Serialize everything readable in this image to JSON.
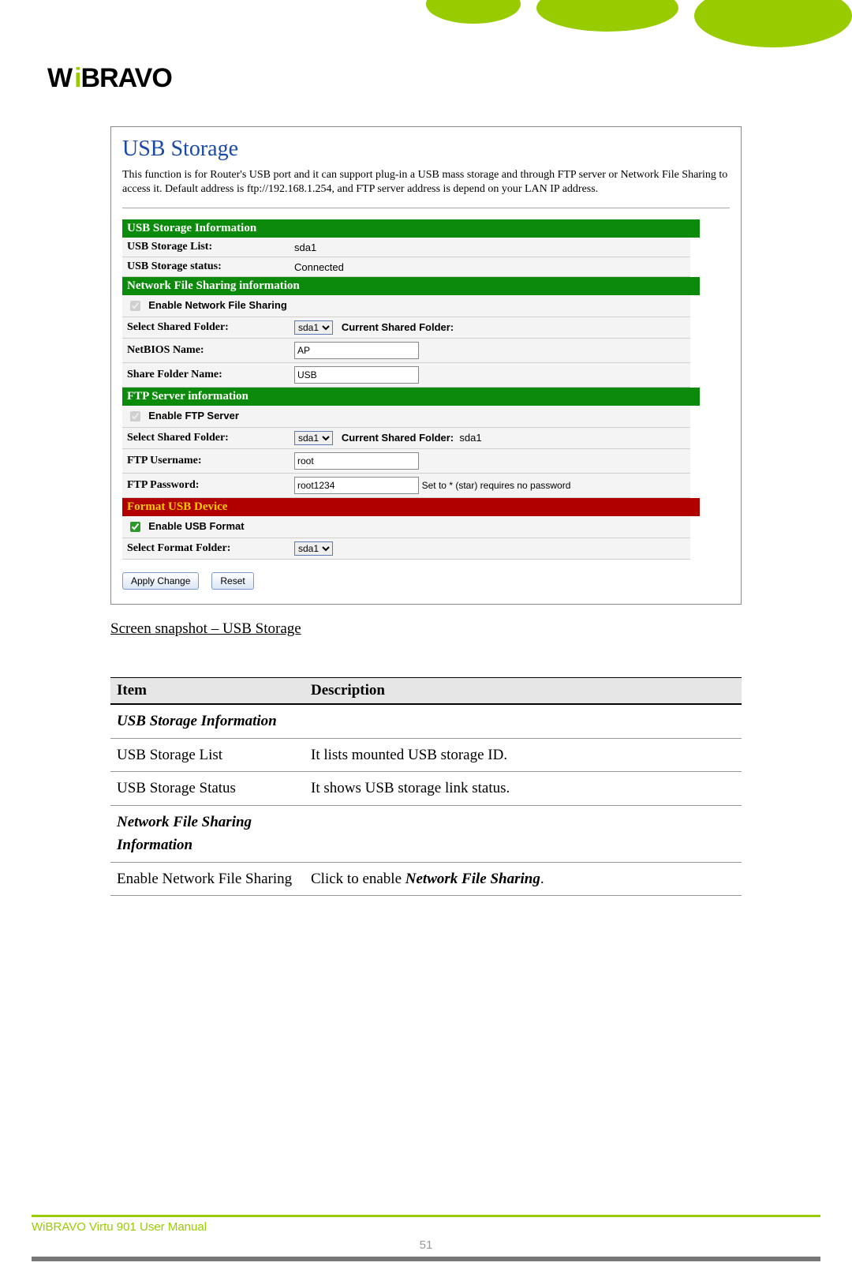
{
  "logo": {
    "text_a": "W",
    "text_dot": "i",
    "text_b": "BRAVO"
  },
  "screenshot": {
    "title": "USB Storage",
    "intro": "This function is for Router's USB port and it can support plug-in a USB mass storage and through FTP server or Network File Sharing to access it. Default address is ftp://192.168.1.254, and FTP server address is depend on your LAN IP address.",
    "sec_usb_info": "USB Storage Information",
    "usb_list_lbl": "USB Storage List:",
    "usb_list_val": "sda1",
    "usb_status_lbl": "USB Storage status:",
    "usb_status_val": "Connected",
    "sec_nfs": "Network File Sharing information",
    "en_nfs_lbl": "Enable Network File Sharing",
    "sel_folder_lbl": "Select Shared Folder:",
    "sel_folder_val": "sda1",
    "cur_folder_lbl": "Current Shared Folder:",
    "netbios_lbl": "NetBIOS Name:",
    "netbios_val": "AP",
    "share_name_lbl": "Share Folder Name:",
    "share_name_val": "USB",
    "sec_ftp": "FTP Server information",
    "en_ftp_lbl": "Enable FTP Server",
    "ftp_sel_folder_lbl": "Select Shared Folder:",
    "ftp_sel_folder_val": "sda1",
    "ftp_cur_folder_lbl": "Current Shared Folder:",
    "ftp_cur_folder_val": "sda1",
    "ftp_user_lbl": "FTP Username:",
    "ftp_user_val": "root",
    "ftp_pass_lbl": "FTP Password:",
    "ftp_pass_val": "root1234",
    "ftp_pass_note": "Set to * (star) requires no password",
    "sec_format": "Format USB Device",
    "en_format_lbl": "Enable USB Format",
    "fmt_sel_lbl": "Select Format Folder:",
    "fmt_sel_val": "sda1",
    "btn_apply": "Apply Change",
    "btn_reset": "Reset"
  },
  "caption": "Screen snapshot – USB Storage",
  "table": {
    "h_item": "Item",
    "h_desc": "Description",
    "r1a": "USB Storage Information",
    "r2a": "USB Storage List",
    "r2b": "It lists mounted USB storage ID.",
    "r3a": "USB Storage Status",
    "r3b": "It shows USB storage link status.",
    "r4a": "Network File Sharing Information",
    "r5a": "Enable Network File Sharing",
    "r5b_pre": "Click to enable ",
    "r5b_bi": "Network File Sharing",
    "r5b_post": "."
  },
  "footer": {
    "manual": "WiBRAVO Virtu 901 User Manual",
    "page": "51"
  }
}
